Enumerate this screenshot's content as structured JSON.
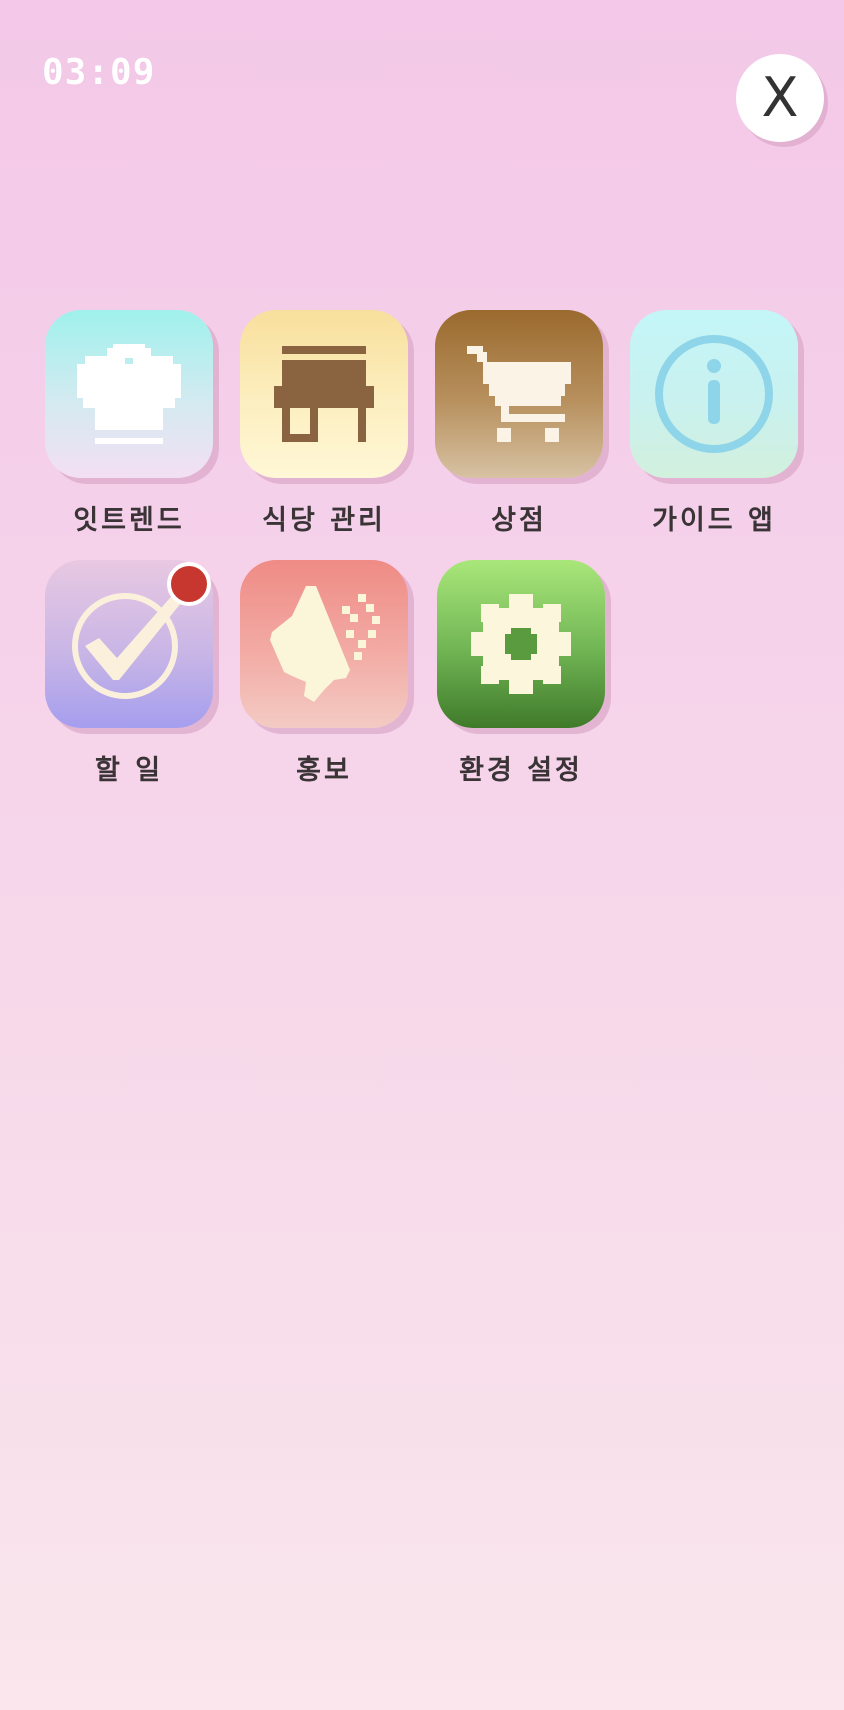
{
  "status": {
    "time": "03:09"
  },
  "close_button": {
    "label": "X"
  },
  "apps": [
    {
      "label": "잇트렌드",
      "icon": "chef-hat-icon"
    },
    {
      "label": "식당 관리",
      "icon": "restaurant-stall-icon"
    },
    {
      "label": "상점",
      "icon": "shopping-cart-icon"
    },
    {
      "label": "가이드 앱",
      "icon": "info-icon"
    },
    {
      "label": "할 일",
      "icon": "checkmark-icon",
      "has_notification": true
    },
    {
      "label": "홍보",
      "icon": "megaphone-icon"
    },
    {
      "label": "환경 설정",
      "icon": "gear-icon"
    }
  ],
  "colors": {
    "background_top": "#f3c8e8",
    "background_bottom": "#fae6ec",
    "notification_dot": "#c7372f",
    "label_text": "#3a3436"
  }
}
